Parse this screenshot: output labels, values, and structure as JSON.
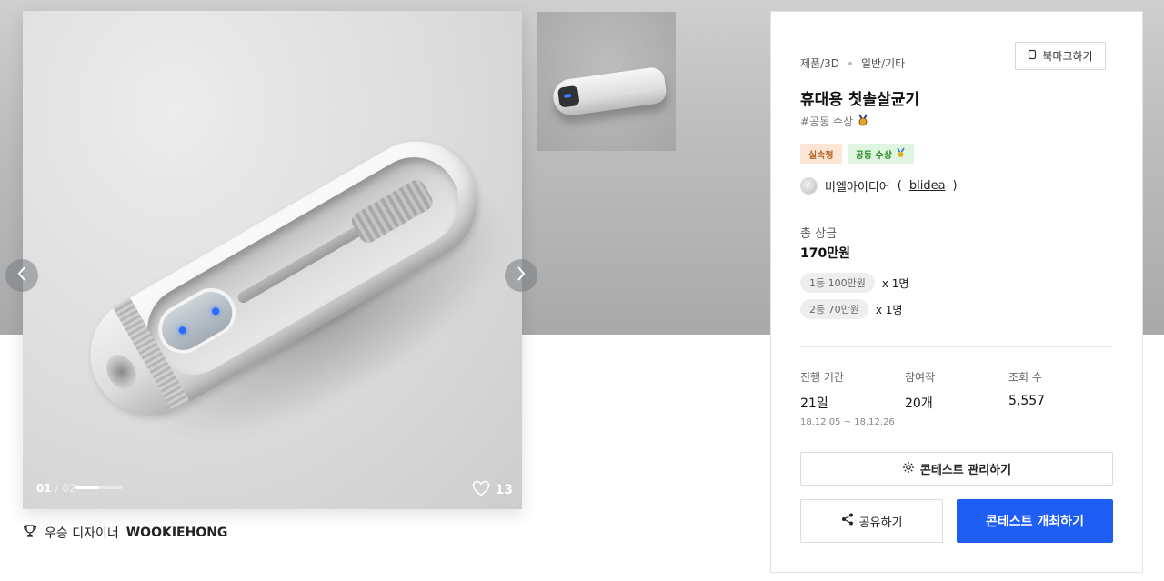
{
  "gallery": {
    "counter_current": "01",
    "counter_separator": " / ",
    "counter_total": "02",
    "slide_progress": 0.5,
    "likes_count": "13",
    "winner_label": "우승 디자이너",
    "winner_name": "WOOKIEHONG"
  },
  "details": {
    "category_primary": "제품/3D",
    "category_secondary": "일반/기타",
    "bookmark_label": "북마크하기",
    "title": "휴대용 칫솔살균기",
    "hashtag": "#공동 수상",
    "badges": {
      "type": "실속형",
      "award": "공동 수상"
    },
    "host": {
      "name": "비엘아이디어",
      "handle_open": "(",
      "handle": "blidea",
      "handle_close": ")"
    },
    "prize": {
      "label": "총 상금",
      "total": "170만원",
      "rows": [
        {
          "rank": "1등 100만원",
          "count": "x 1명"
        },
        {
          "rank": "2등 70만원",
          "count": "x 1명"
        }
      ]
    },
    "stats": {
      "period_label": "진행 기간",
      "period_value": "21일",
      "period_dates": "18.12.05 ~ 18.12.26",
      "entries_label": "참여작",
      "entries_value": "20개",
      "views_label": "조회 수",
      "views_value": "5,557"
    },
    "actions": {
      "manage": "콘테스트 관리하기",
      "share": "공유하기",
      "host_contest": "콘테스트 개최하기"
    }
  },
  "colors": {
    "primary_button": "#1e5ef5",
    "badge_type_bg": "#fbe5d4",
    "badge_award_bg": "#dff5df"
  },
  "icons": {
    "prev": "chevron-left-icon",
    "next": "chevron-right-icon",
    "like": "heart-icon",
    "trophy": "trophy-icon",
    "bookmark": "bookmark-icon",
    "gear": "gear-icon",
    "share": "share-icon",
    "medal": "medal-icon"
  }
}
